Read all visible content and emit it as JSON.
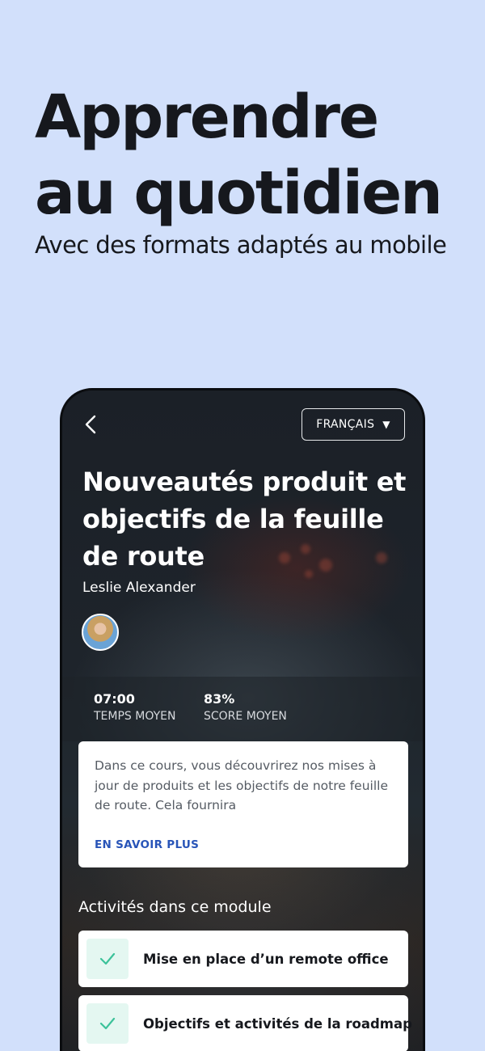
{
  "promo": {
    "headline_line1": "Apprendre",
    "headline_line2": "au quotidien",
    "subheadline": "Avec des formats adaptés au mobile"
  },
  "app": {
    "language_selector": "FRANÇAIS",
    "course_title": "Nouveautés produit et objectifs de la feuille de route",
    "author": "Leslie Alexander",
    "stats": [
      {
        "value": "07:00",
        "label": "TEMPS MOYEN"
      },
      {
        "value": "83%",
        "label": "SCORE MOYEN"
      }
    ],
    "description": "Dans ce cours, vous découvrirez nos mises à jour de produits et les objectifs de notre feuille de route. Cela fournira",
    "learn_more": "EN SAVOIR PLUS",
    "activities_heading": "Activités dans ce module",
    "activities": [
      {
        "title": "Mise en place d’un remote office",
        "status": "completed"
      },
      {
        "title": "Objectifs et activités de la roadmap",
        "status": "completed"
      }
    ]
  },
  "colors": {
    "background": "#d2e0fb",
    "phone_bg": "#15191e",
    "link": "#2854b8",
    "check": "#3cc29a",
    "check_bg": "#e4f7f1"
  },
  "icons": [
    "chevron-left-icon",
    "caret-down-icon",
    "checkmark-icon"
  ]
}
